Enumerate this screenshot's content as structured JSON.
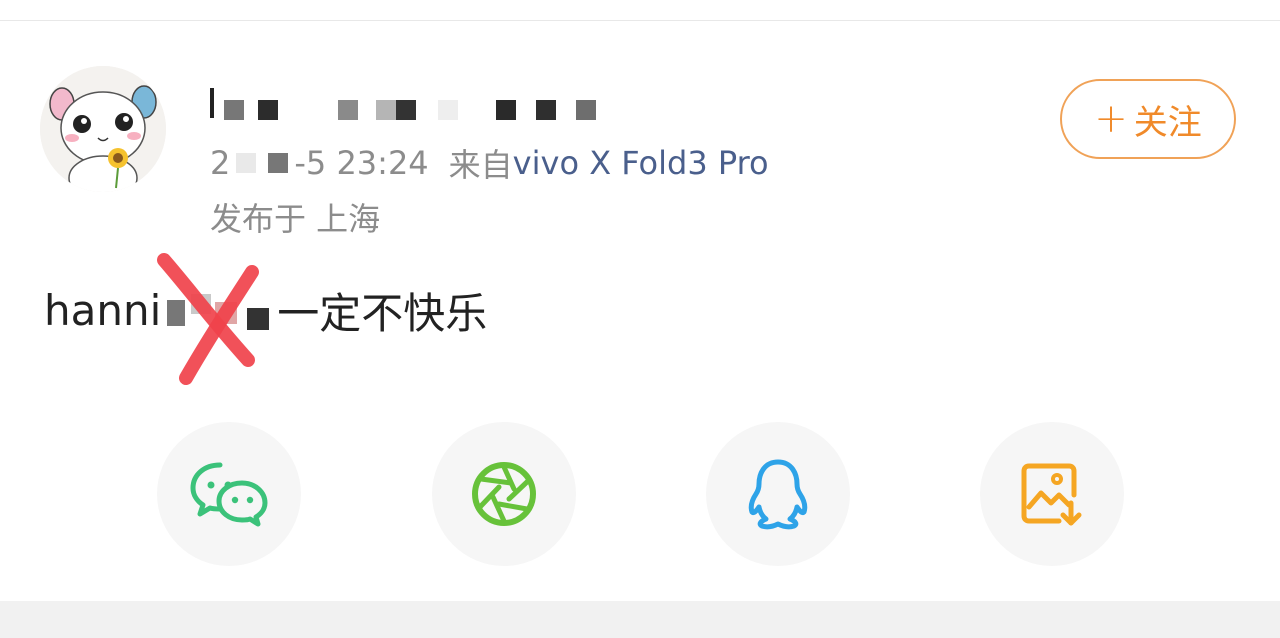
{
  "post": {
    "author": {
      "name_visible_prefix": "",
      "avatar": "hamster-avatar-icon"
    },
    "meta": {
      "date_prefix": "2",
      "date_suffix": "-5 23:24",
      "source_label": "来自",
      "device": "vivo X Fold3 Pro"
    },
    "location": "发布于 上海",
    "follow_label": "关注",
    "follow_plus": "+",
    "text_before": "hanni",
    "text_after": "一定不快乐"
  },
  "share": {
    "items": [
      {
        "icon": "wechat-icon",
        "color": "#3bc27a"
      },
      {
        "icon": "moments-icon",
        "color": "#67c23a"
      },
      {
        "icon": "qq-icon",
        "color": "#2ea3e8"
      },
      {
        "icon": "save-image-icon",
        "color": "#f5a623"
      }
    ]
  },
  "colors": {
    "follow": "#f08a2a",
    "device_link": "#4a5f8c",
    "meta_text": "#8c8c8c",
    "scribble": "#f0424b"
  }
}
